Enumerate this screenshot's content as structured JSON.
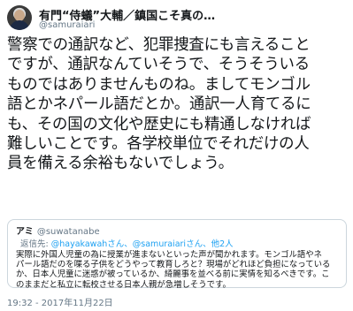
{
  "author": {
    "name": "有門“侍蟻”大輔／鎮国こそ真の…",
    "handle": "@samuraiari"
  },
  "tweet": {
    "lines": [
      "警察での通訳など、犯罪捜査にも言えること",
      "ですが、通訳なんていそうで、そうそういる",
      "ものではありませんものね。ましてモンゴル",
      "語とかネパール語だとか。通訳一人育てるに",
      "も、その国の文化や歴史にも精通しなければ",
      "難しいことです。各学校単位でそれだけの人",
      "員を備える余裕もないでしょう。"
    ]
  },
  "quote": {
    "name": "アミ",
    "handle": "@suwatanabe",
    "reply_prefix": "返信先:",
    "reply_handles": "@hayakawahさん、@samuraiariさん、他2人",
    "lines": [
      "実際に外国人児童の為に授業が進まないといった声が聞かれます。モンゴル語やネ",
      "パール語だのを喋る子供をどうやって教育しろと？現場がどれほど負担になっている",
      "か、日本人児童に迷惑が被っているか、綺麗事を並べる前に実情を知るべきです。こ",
      "のままだと私立に転校させる日本人親が急増しそうです。"
    ]
  },
  "timestamp": "19:32 - 2017年11月22日"
}
